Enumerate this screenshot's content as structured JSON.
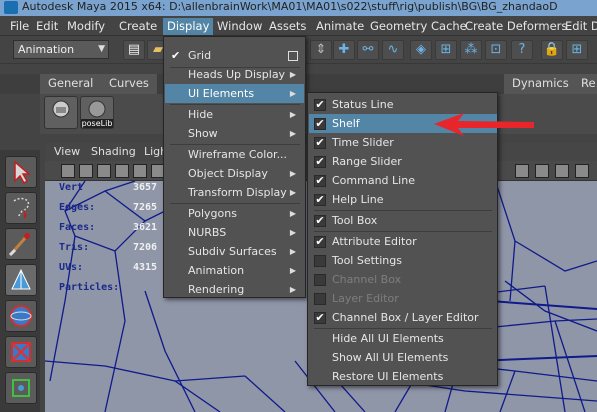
{
  "window": {
    "title": "Autodesk Maya 2015 x64: D:\\allenbrainWork\\MA01\\MA01\\s022\\stuff\\rig\\publish\\BG\\BG_zhandaoD"
  },
  "menubar": {
    "items": [
      "File",
      "Edit",
      "Modify",
      "Create",
      "Display",
      "Window",
      "Assets",
      "Animate",
      "Geometry Cache",
      "Create Deformers",
      "Edit De"
    ]
  },
  "statusline": {
    "mode": "Animation"
  },
  "shelf": {
    "tabs": [
      "General",
      "Curves",
      "Dynamics",
      "Re"
    ],
    "icon_label": "poseLib"
  },
  "viewport": {
    "menu": [
      "View",
      "Shading",
      "Ligh"
    ],
    "hud": [
      {
        "label": "Vert",
        "value": "3657"
      },
      {
        "label": "Edges:",
        "value": "7265"
      },
      {
        "label": "Faces:",
        "value": "3621"
      },
      {
        "label": "Tris:",
        "value": "7206"
      },
      {
        "label": "UVs:",
        "value": "4315"
      },
      {
        "label": "Particles:",
        "value": ""
      }
    ]
  },
  "display_menu": {
    "items": [
      {
        "label": "Grid",
        "checked": true,
        "option_box": true
      },
      {
        "label": "Heads Up Display",
        "submenu": true
      },
      {
        "label": "UI Elements",
        "submenu": true,
        "active": true
      },
      {
        "label": "Hide",
        "submenu": true
      },
      {
        "label": "Show",
        "submenu": true
      },
      {
        "label": "Wireframe Color..."
      },
      {
        "label": "Object Display",
        "submenu": true
      },
      {
        "label": "Transform Display",
        "submenu": true
      },
      {
        "label": "Polygons",
        "submenu": true
      },
      {
        "label": "NURBS",
        "submenu": true
      },
      {
        "label": "Subdiv Surfaces",
        "submenu": true
      },
      {
        "label": "Animation",
        "submenu": true
      },
      {
        "label": "Rendering",
        "submenu": true
      }
    ]
  },
  "ui_elements_menu": {
    "items": [
      {
        "label": "Status Line",
        "checked": true
      },
      {
        "label": "Shelf",
        "checked": true,
        "highlighted": true
      },
      {
        "label": "Time Slider",
        "checked": true
      },
      {
        "label": "Range Slider",
        "checked": true
      },
      {
        "label": "Command Line",
        "checked": true
      },
      {
        "label": "Help Line",
        "checked": true
      },
      {
        "label": "Tool Box",
        "checked": true
      },
      {
        "label": "Attribute Editor",
        "checked": true
      },
      {
        "label": "Tool Settings",
        "checked": false
      },
      {
        "label": "Channel Box",
        "checked": false,
        "disabled": true
      },
      {
        "label": "Layer Editor",
        "checked": false,
        "disabled": true
      },
      {
        "label": "Channel Box / Layer Editor",
        "checked": true
      },
      {
        "label": "Hide All UI Elements"
      },
      {
        "label": "Show All UI Elements"
      },
      {
        "label": "Restore UI Elements"
      }
    ]
  },
  "colors": {
    "highlight": "#5285a6",
    "annotation_arrow": "#e8252b",
    "hud_label": "#1b2a8a",
    "mesh": "#101a8a"
  }
}
